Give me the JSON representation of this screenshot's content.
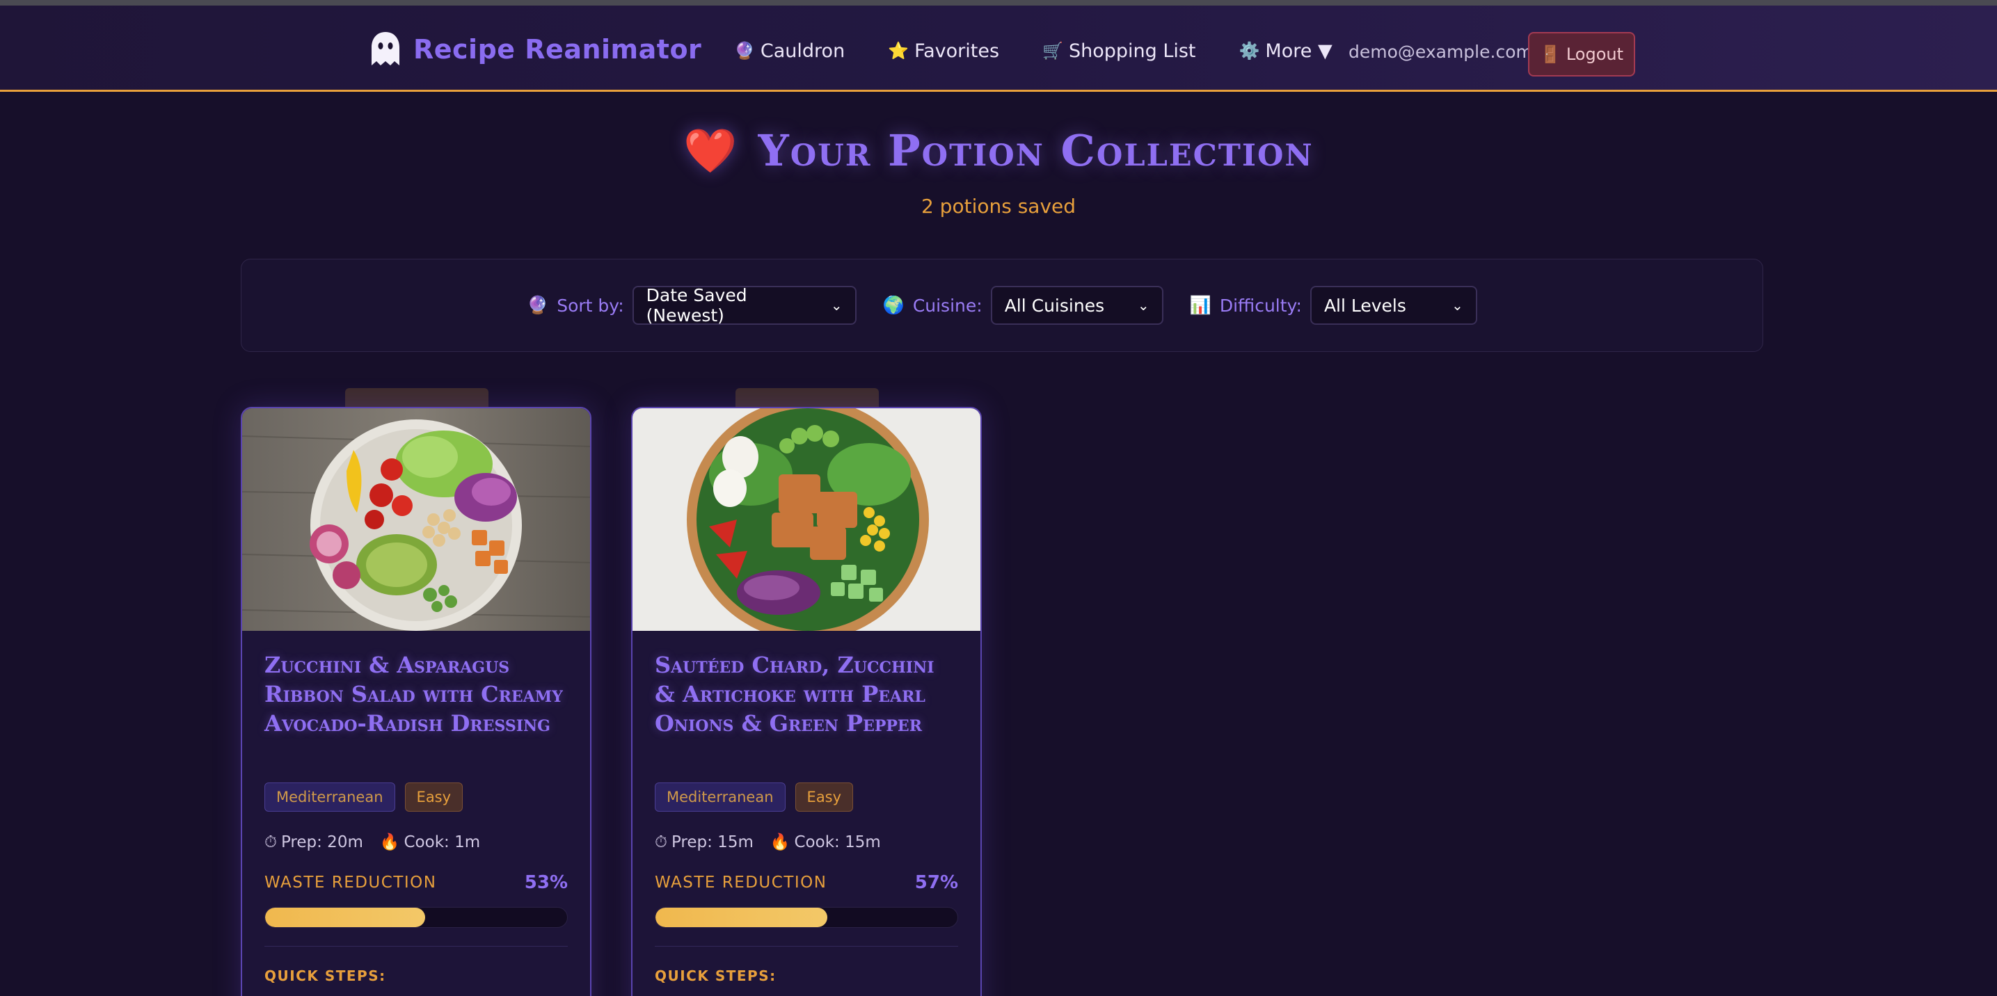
{
  "app": {
    "title": "Recipe Reanimator"
  },
  "nav": {
    "items": [
      {
        "icon": "🔮",
        "label": "Cauldron"
      },
      {
        "icon": "⭐",
        "label": "Favorites"
      },
      {
        "icon": "🛒",
        "label": "Shopping List"
      },
      {
        "icon": "⚙️",
        "label": "More ▼"
      }
    ],
    "user_email": "demo@example.com",
    "logout_icon": "🚪",
    "logout_label": "Logout"
  },
  "header": {
    "title": "Your Potion Collection",
    "heart_icon": "❤️",
    "subtitle": "2 potions saved"
  },
  "filters": {
    "sort": {
      "icon": "🔮",
      "label": "Sort by:",
      "value": "Date Saved (Newest)"
    },
    "cuisine": {
      "icon": "🌍",
      "label": "Cuisine:",
      "value": "All Cuisines"
    },
    "difficulty": {
      "icon": "📊",
      "label": "Difficulty:",
      "value": "All Levels"
    }
  },
  "cards": [
    {
      "title": "Zucchini & Asparagus Ribbon Salad with Creamy Avocado-Radish Dressing",
      "cuisine": "Mediterranean",
      "difficulty": "Easy",
      "prep": "Prep: 20m",
      "cook": "Cook: 1m",
      "waste_label": "WASTE REDUCTION",
      "waste_pct_label": "53%",
      "waste_pct": 53,
      "quick_steps": "QUICK STEPS:"
    },
    {
      "title": "Sautéed Chard, Zucchini & Artichoke with Pearl Onions & Green Pepper",
      "cuisine": "Mediterranean",
      "difficulty": "Easy",
      "prep": "Prep: 15m",
      "cook": "Cook: 15m",
      "waste_label": "WASTE REDUCTION",
      "waste_pct_label": "57%",
      "waste_pct": 57,
      "quick_steps": "QUICK STEPS:"
    }
  ],
  "colors": {
    "accent": "#8f6ff2",
    "highlight": "#e8a03c",
    "background": "#170f2a",
    "logout": "#5a2335"
  }
}
